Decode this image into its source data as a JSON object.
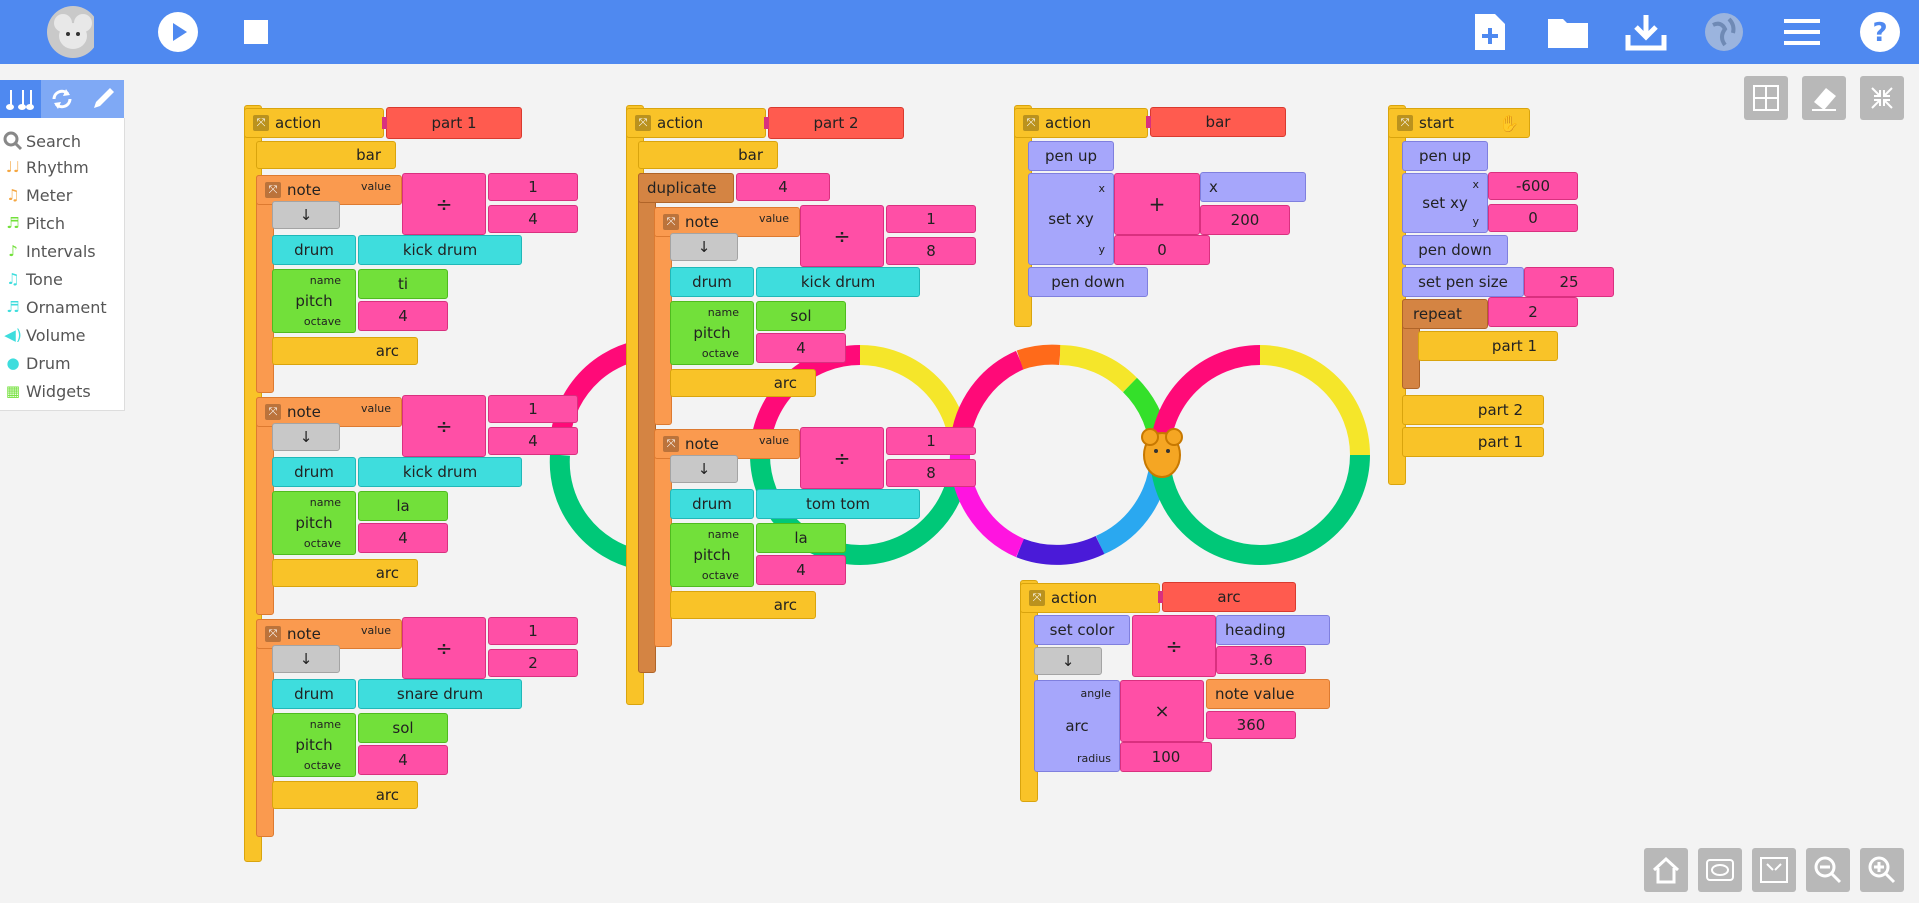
{
  "toolbar": {
    "left": [
      "mouse-logo",
      "play-icon",
      "stop-icon"
    ],
    "right": [
      "new-file-icon",
      "open-folder-icon",
      "save-download-icon",
      "language-globe-icon",
      "menu-icon",
      "help-icon"
    ],
    "accent": "#4f89f0"
  },
  "palette": {
    "tabs": [
      "music-notes-icon",
      "refresh-icon",
      "pen-icon"
    ],
    "items": [
      {
        "label": "Search",
        "icon": "search-icon",
        "color": "#888888"
      },
      {
        "label": "Rhythm",
        "icon": "rhythm-icon",
        "color": "#f5a742"
      },
      {
        "label": "Meter",
        "icon": "meter-icon",
        "color": "#f5a742"
      },
      {
        "label": "Pitch",
        "icon": "pitch-icon",
        "color": "#72e03a"
      },
      {
        "label": "Intervals",
        "icon": "intervals-icon",
        "color": "#72e03a"
      },
      {
        "label": "Tone",
        "icon": "tone-icon",
        "color": "#3edddd"
      },
      {
        "label": "Ornament",
        "icon": "ornament-icon",
        "color": "#3edddd"
      },
      {
        "label": "Volume",
        "icon": "volume-icon",
        "color": "#3edddd"
      },
      {
        "label": "Drum",
        "icon": "drum-icon",
        "color": "#3edddd"
      },
      {
        "label": "Widgets",
        "icon": "widgets-icon",
        "color": "#72e03a"
      }
    ]
  },
  "canvas_buttons": [
    "grid-icon",
    "clear-eraser-icon",
    "collapse-icon"
  ],
  "bottom_buttons": [
    "home-icon",
    "hide-blocks-icon",
    "collapse-blocks-icon",
    "zoom-out-icon",
    "zoom-in-icon"
  ],
  "stacks": {
    "part1": {
      "action": "action",
      "name": "part 1",
      "bar": "bar",
      "notes": [
        {
          "note": "note",
          "value": "value",
          "num": "1",
          "den": "4",
          "div": "÷",
          "arrow": "↓",
          "drum": "drum",
          "drum_name": "kick drum",
          "name_lbl": "name",
          "pitch": "pitch",
          "octave_lbl": "octave",
          "pitch_name": "ti",
          "octave": "4",
          "arc": "arc"
        },
        {
          "note": "note",
          "value": "value",
          "num": "1",
          "den": "4",
          "div": "÷",
          "arrow": "↓",
          "drum": "drum",
          "drum_name": "kick drum",
          "name_lbl": "name",
          "pitch": "pitch",
          "octave_lbl": "octave",
          "pitch_name": "la",
          "octave": "4",
          "arc": "arc"
        },
        {
          "note": "note",
          "value": "value",
          "num": "1",
          "den": "2",
          "div": "÷",
          "arrow": "↓",
          "drum": "drum",
          "drum_name": "snare drum",
          "name_lbl": "name",
          "pitch": "pitch",
          "octave_lbl": "octave",
          "pitch_name": "sol",
          "octave": "4",
          "arc": "arc"
        }
      ]
    },
    "part2": {
      "action": "action",
      "name": "part 2",
      "bar": "bar",
      "duplicate": "duplicate",
      "dup_count": "4",
      "notes": [
        {
          "note": "note",
          "value": "value",
          "num": "1",
          "den": "8",
          "div": "÷",
          "arrow": "↓",
          "drum": "drum",
          "drum_name": "kick drum",
          "name_lbl": "name",
          "pitch": "pitch",
          "octave_lbl": "octave",
          "pitch_name": "sol",
          "octave": "4",
          "arc": "arc"
        },
        {
          "note": "note",
          "value": "value",
          "num": "1",
          "den": "8",
          "div": "÷",
          "arrow": "↓",
          "drum": "drum",
          "drum_name": "tom tom",
          "name_lbl": "name",
          "pitch": "pitch",
          "octave_lbl": "octave",
          "pitch_name": "la",
          "octave": "4",
          "arc": "arc"
        }
      ]
    },
    "bar": {
      "action": "action",
      "name": "bar",
      "pen_up": "pen up",
      "set_xy": "set xy",
      "x_lbl": "x",
      "y_lbl": "y",
      "plus": "+",
      "x_var": "x",
      "x_add": "200",
      "y_val": "0",
      "pen_down": "pen down"
    },
    "start": {
      "start": "start",
      "pen_up": "pen up",
      "set_xy": "set xy",
      "x_lbl": "x",
      "y_lbl": "y",
      "x_val": "-600",
      "y_val": "0",
      "pen_down": "pen down",
      "set_pen_size": "set pen size",
      "pen_size": "25",
      "repeat": "repeat",
      "repeat_count": "2",
      "part1": "part 1",
      "part2": "part 2",
      "part1b": "part 1"
    },
    "arc": {
      "action": "action",
      "name": "arc",
      "set_color": "set color",
      "div": "÷",
      "heading": "heading",
      "divisor": "3.6",
      "arrow": "↓",
      "angle_lbl": "angle",
      "arc": "arc",
      "radius_lbl": "radius",
      "times": "×",
      "note_value": "note value",
      "mult": "360",
      "radius": "100"
    }
  }
}
